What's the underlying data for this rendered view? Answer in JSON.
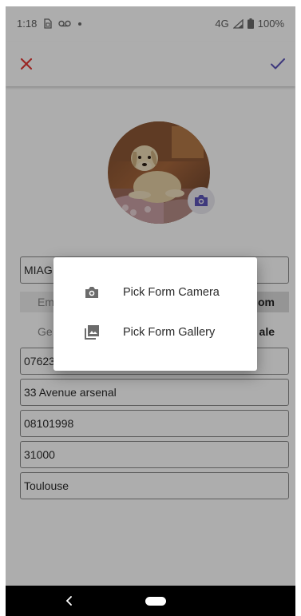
{
  "status_bar": {
    "time": "1:18",
    "network": "4G",
    "battery": "100%",
    "icons": [
      "sim-icon",
      "voicemail-icon",
      "dot-icon",
      "signal-icon",
      "battery-icon"
    ]
  },
  "toolbar": {
    "close_icon": "close-icon",
    "confirm_icon": "check-icon",
    "accent_close": "#e53935",
    "accent_check": "#5c55b8"
  },
  "profile": {
    "avatar": "dog-photo",
    "camera_badge_icon": "camera-icon",
    "accent": "#5c55b8"
  },
  "form": {
    "name_value": "MIAG",
    "role_toggle": {
      "left": "Em",
      "right": "om"
    },
    "gender_toggle": {
      "left": "Ge",
      "right": "ale"
    },
    "phone_value": "07623",
    "address_value": "33 Avenue arsenal",
    "birthdate_value": "08101998",
    "postal_value": "31000",
    "city_value": "Toulouse"
  },
  "dialog": {
    "items": [
      {
        "label": "Pick Form Camera",
        "icon": "camera-icon"
      },
      {
        "label": "Pick Form Gallery",
        "icon": "gallery-icon"
      }
    ]
  },
  "nav_bar": {
    "back_icon": "back-chevron-icon",
    "home_icon": "home-pill-icon"
  }
}
